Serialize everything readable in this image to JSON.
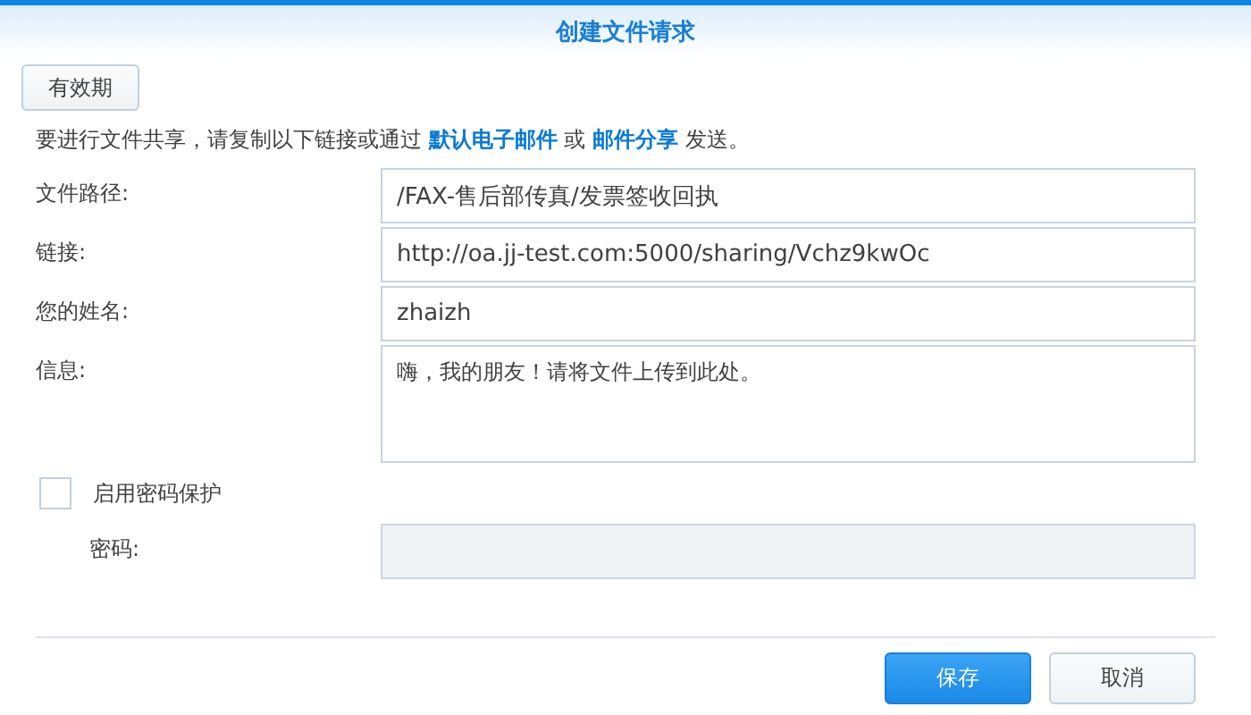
{
  "window": {
    "title": "创建文件请求"
  },
  "expiry_button": "有效期",
  "intro": {
    "before": "要进行文件共享，请复制以下链接或通过 ",
    "link_1": "默认电子邮件",
    "middle": " 或 ",
    "link_2": "邮件分享",
    "after": " 发送。"
  },
  "fields": [
    {
      "label": "文件路径:",
      "value": "/FAX-售后部传真/发票签收回执",
      "kind": "text"
    },
    {
      "label": "链接:",
      "value": "http://oa.jj-test.com:5000/sharing/Vchz9kwOc",
      "kind": "text"
    },
    {
      "label": "您的姓名:",
      "value": "zhaizh",
      "kind": "text"
    },
    {
      "label": "信息:",
      "value": "嗨，我的朋友！请将文件上传到此处。",
      "kind": "multiline"
    }
  ],
  "password_protection": {
    "label": "启用密码保护",
    "checked": false
  },
  "password": {
    "label": "密码:",
    "disabled": true
  },
  "buttons": [
    {
      "label": "保存",
      "kind": "primary"
    },
    {
      "label": "取消",
      "kind": "secondary"
    }
  ]
}
